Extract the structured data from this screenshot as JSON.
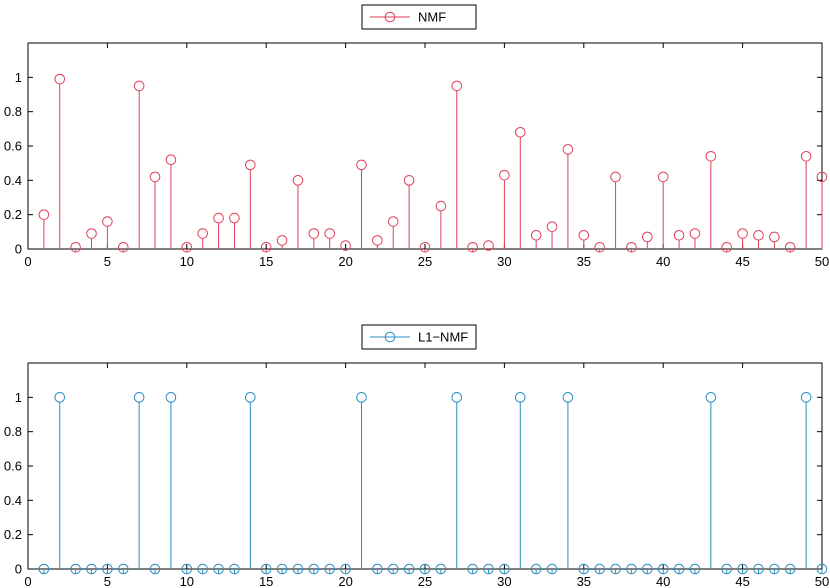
{
  "chart_data": [
    {
      "type": "stem",
      "legend": "NMF",
      "color": "#e0405a",
      "x": [
        1,
        2,
        3,
        4,
        5,
        6,
        7,
        8,
        9,
        10,
        11,
        12,
        13,
        14,
        15,
        16,
        17,
        18,
        19,
        20,
        21,
        22,
        23,
        24,
        25,
        26,
        27,
        28,
        29,
        30,
        31,
        32,
        33,
        34,
        35,
        36,
        37,
        38,
        39,
        40,
        41,
        42,
        43,
        44,
        45,
        46,
        47,
        48,
        49,
        50
      ],
      "values": [
        0.2,
        0.99,
        0.01,
        0.09,
        0.16,
        0.01,
        0.95,
        0.42,
        0.52,
        0.01,
        0.09,
        0.18,
        0.18,
        0.49,
        0.01,
        0.05,
        0.4,
        0.09,
        0.09,
        0.02,
        0.49,
        0.05,
        0.16,
        0.4,
        0.01,
        0.25,
        0.95,
        0.01,
        0.02,
        0.43,
        0.68,
        0.08,
        0.13,
        0.58,
        0.08,
        0.01,
        0.42,
        0.01,
        0.07,
        0.42,
        0.08,
        0.09,
        0.54,
        0.01,
        0.09,
        0.08,
        0.07,
        0.01,
        0.54,
        0.42
      ],
      "xlim": [
        0,
        50
      ],
      "ylim": [
        0,
        1.2
      ],
      "xticks": [
        "0",
        "5",
        "10",
        "15",
        "20",
        "25",
        "30",
        "35",
        "40",
        "45",
        "50"
      ],
      "yticks": [
        "0",
        "0.2",
        "0.4",
        "0.6",
        "0.8",
        "1"
      ],
      "legend_placement": "top-center"
    },
    {
      "type": "stem",
      "legend": "L1−NMF",
      "color": "#2a8fc0",
      "x": [
        1,
        2,
        3,
        4,
        5,
        6,
        7,
        8,
        9,
        10,
        11,
        12,
        13,
        14,
        15,
        16,
        17,
        18,
        19,
        20,
        21,
        22,
        23,
        24,
        25,
        26,
        27,
        28,
        29,
        30,
        31,
        32,
        33,
        34,
        35,
        36,
        37,
        38,
        39,
        40,
        41,
        42,
        43,
        44,
        45,
        46,
        47,
        48,
        49,
        50
      ],
      "values": [
        0,
        1,
        0,
        0,
        0,
        0,
        1,
        0,
        1,
        0,
        0,
        0,
        0,
        1,
        0,
        0,
        0,
        0,
        0,
        0,
        1,
        0,
        0,
        0,
        0,
        0,
        1,
        0,
        0,
        0,
        1,
        0,
        0,
        1,
        0,
        0,
        0,
        0,
        0,
        0,
        0,
        0,
        1,
        0,
        0,
        0,
        0,
        0,
        1,
        0
      ],
      "xlim": [
        0,
        50
      ],
      "ylim": [
        0,
        1.2
      ],
      "xticks": [
        "0",
        "5",
        "10",
        "15",
        "20",
        "25",
        "30",
        "35",
        "40",
        "45",
        "50"
      ],
      "yticks": [
        "0",
        "0.2",
        "0.4",
        "0.6",
        "0.8",
        "1"
      ],
      "legend_placement": "top-center"
    }
  ]
}
